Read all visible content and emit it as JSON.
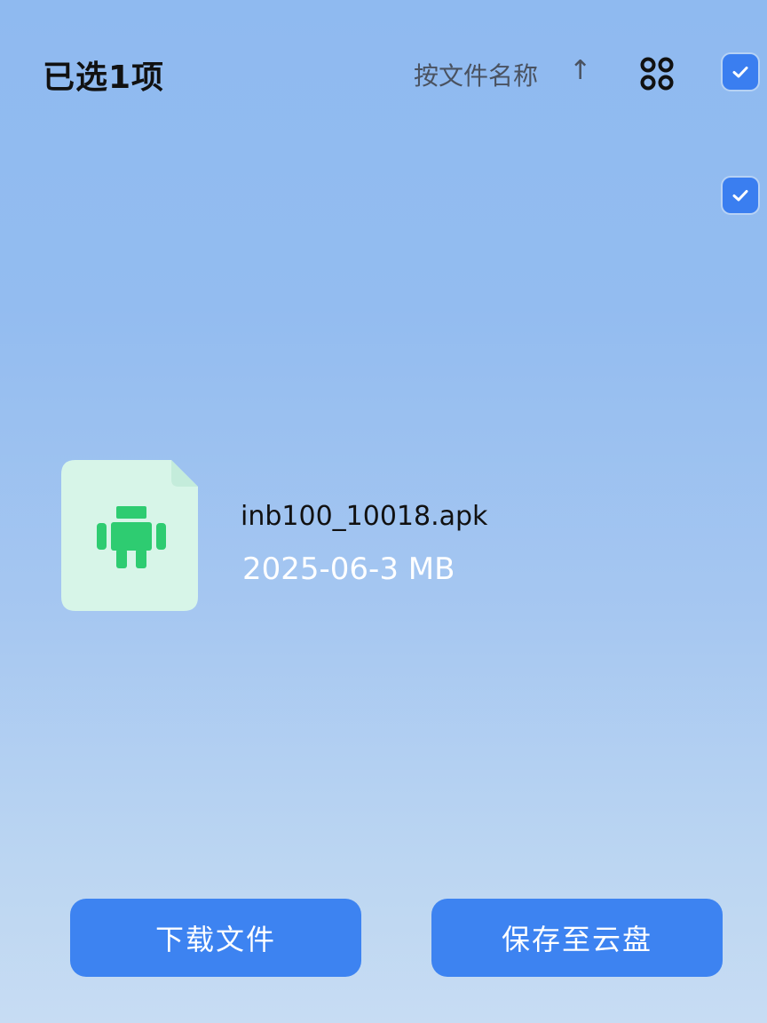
{
  "header": {
    "title": "已选1项",
    "sort_label": "按文件名称",
    "sort_arrow": "↑"
  },
  "file": {
    "name": "inb100_10018.apk",
    "meta": "2025-06-3 MB",
    "icon": "android-icon",
    "selected": true
  },
  "actions": {
    "download_label": "下载文件",
    "save_label": "保存至云盘"
  },
  "colors": {
    "accent": "#3d83f1",
    "checkbox": "#3a7ef0",
    "android_green": "#2ecc71",
    "file_icon_bg": "#d7f5e8"
  }
}
